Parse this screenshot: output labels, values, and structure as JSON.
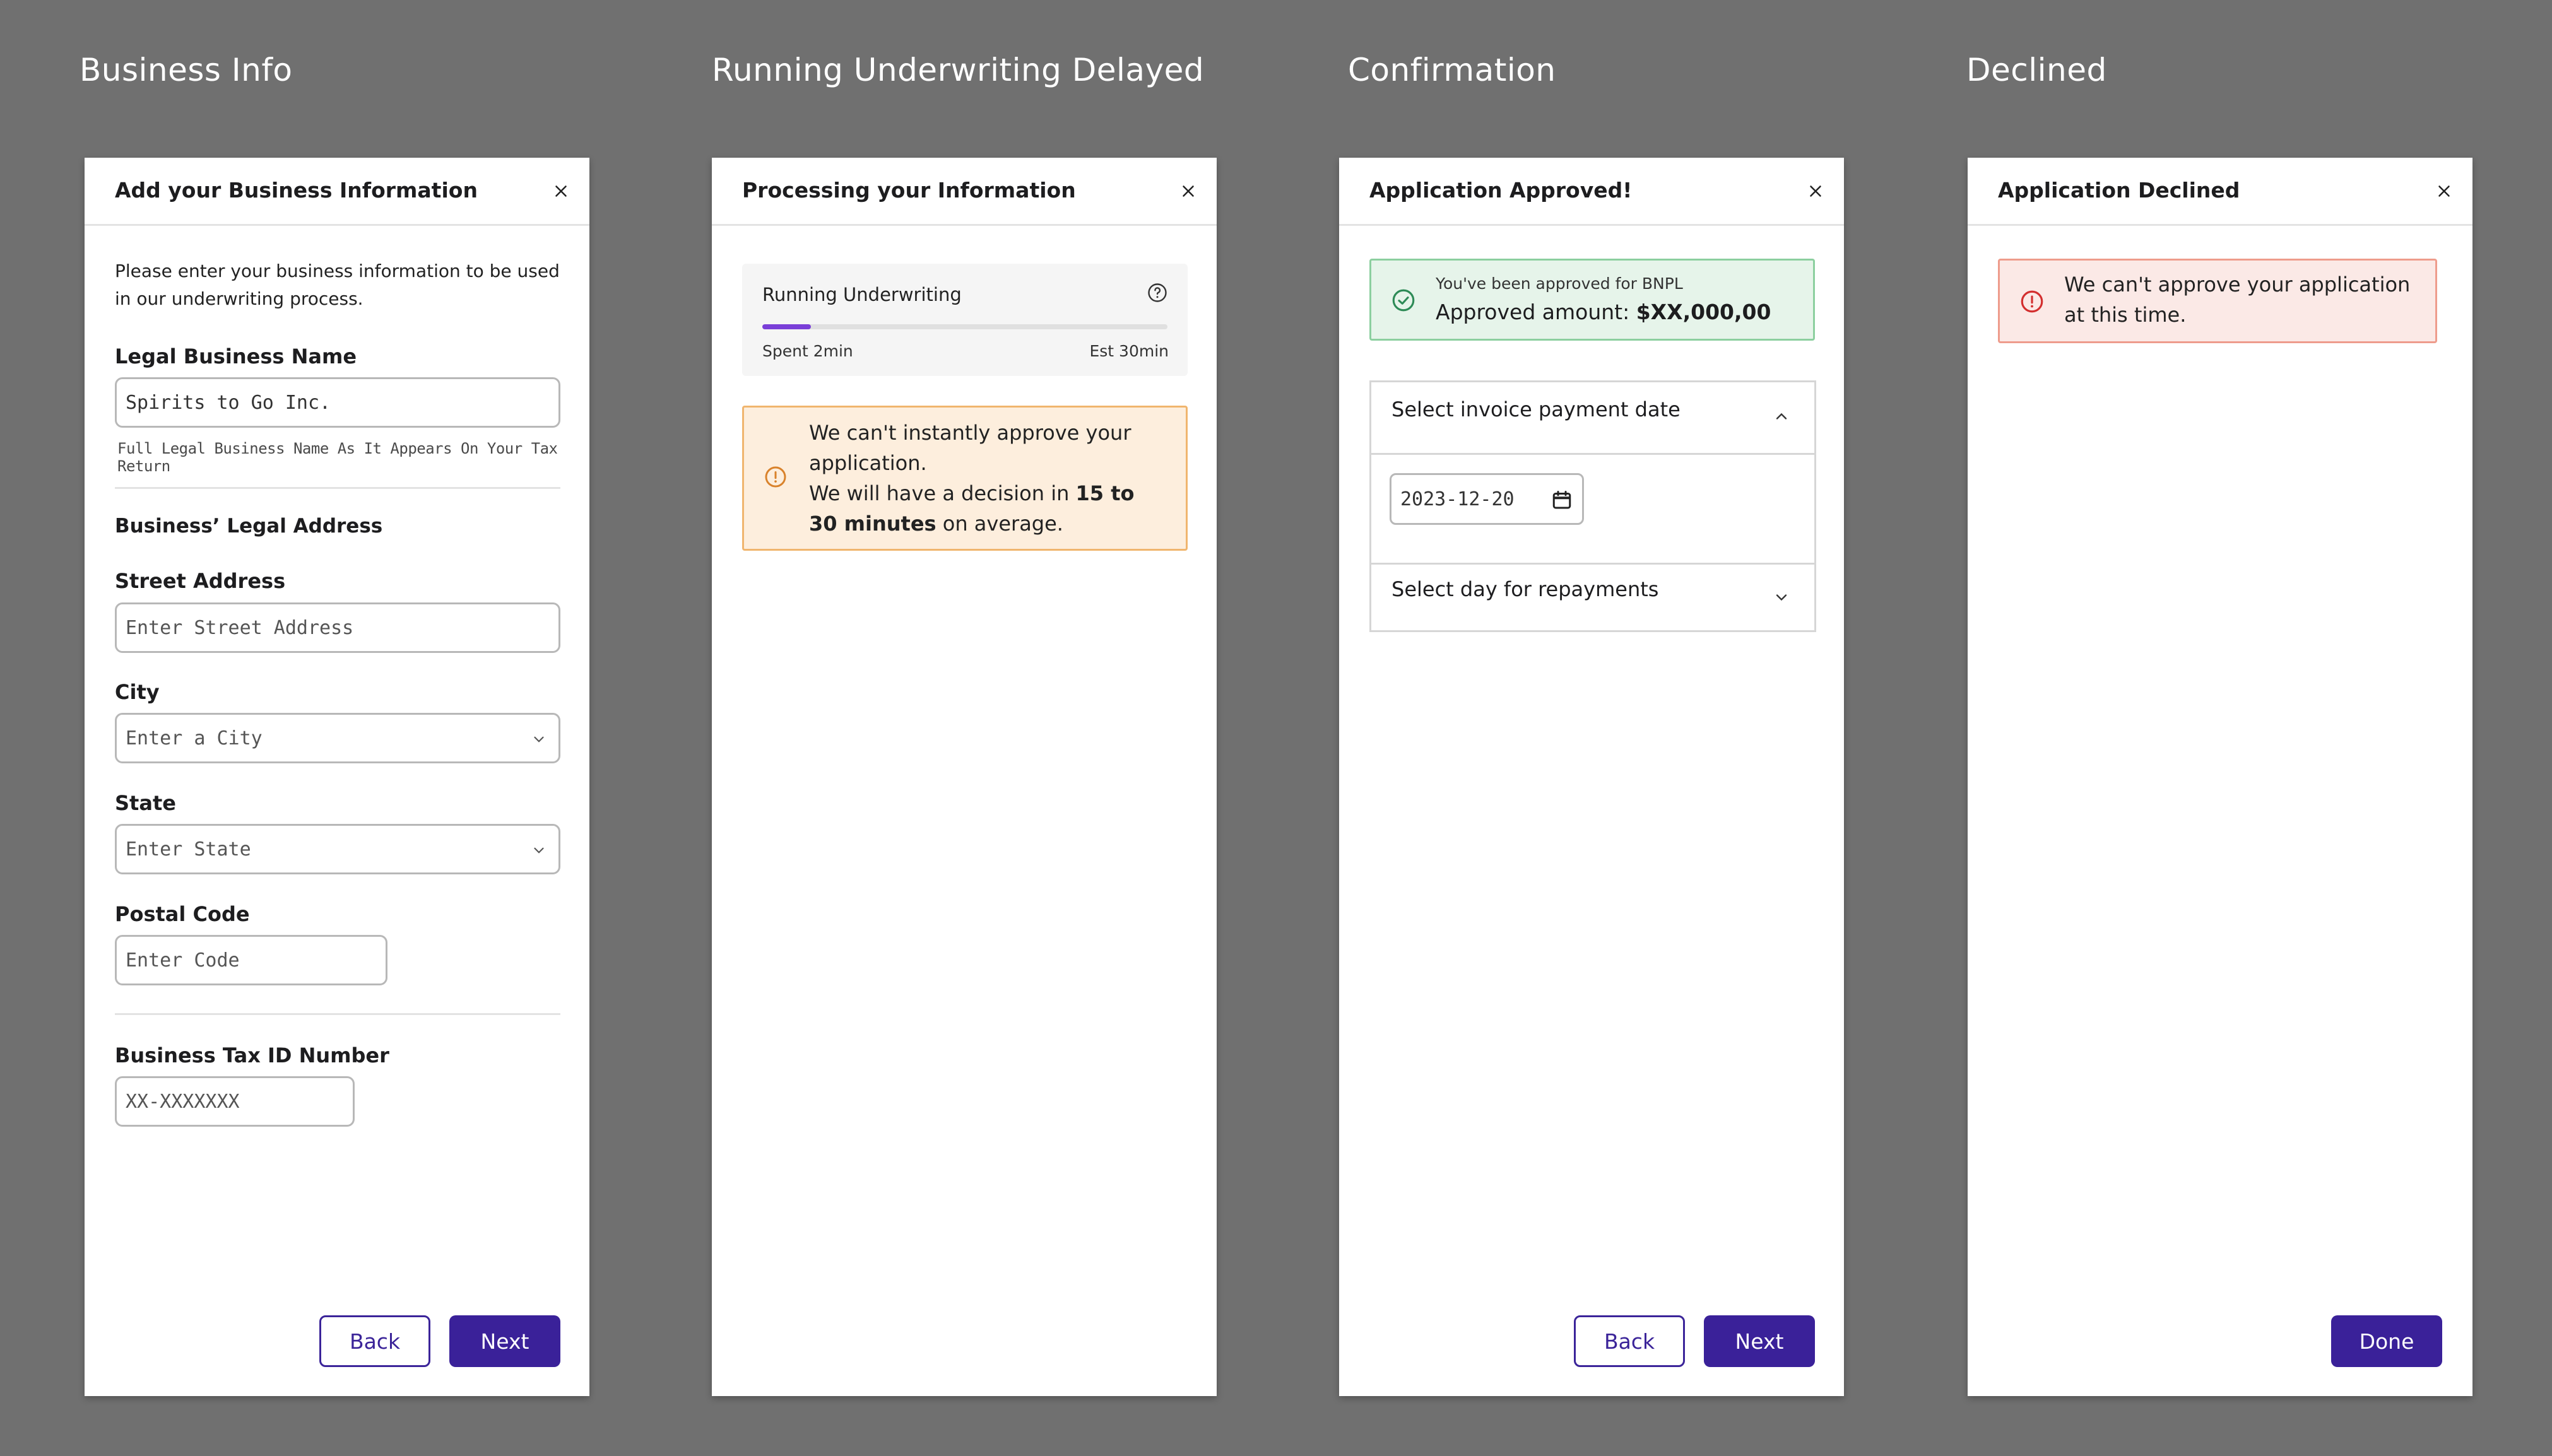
{
  "columns": {
    "business_info": "Business Info",
    "running_underwriting": "Running Underwriting Delayed",
    "confirmation": "Confirmation",
    "declined": "Declined"
  },
  "business_form": {
    "title": "Add your Business Information",
    "intro": "Please enter your business information to be used in our underwriting process.",
    "legal_name_label": "Legal Business Name",
    "legal_name_value": "Spirits to Go Inc.",
    "legal_name_helper": "Full Legal Business Name As It Appears On Your Tax Return",
    "address_section": "Business’ Legal Address",
    "street_label": "Street Address",
    "street_placeholder": "Enter Street Address",
    "city_label": "City",
    "city_placeholder": "Enter a City",
    "state_label": "State",
    "state_placeholder": "Enter State",
    "postal_label": "Postal Code",
    "postal_placeholder": "Enter Code",
    "tax_label": "Business Tax ID Number",
    "tax_placeholder": "XX-XXXXXXX",
    "back": "Back",
    "next": "Next"
  },
  "processing": {
    "title": "Processing your Information",
    "card_title": "Running Underwriting",
    "progress_fraction": 0.12,
    "spent": "Spent 2min",
    "est": "Est 30min",
    "warn_line1": "We can't instantly approve your application.",
    "warn_line2_pre": "We will have a decision in ",
    "warn_line2_bold": "15 to 30 minutes",
    "warn_line2_post": " on average."
  },
  "confirmation": {
    "title": "Application Approved!",
    "approved_small": "You've been approved for BNPL",
    "approved_label": "Approved amount: ",
    "approved_amount": "$XX,000,00",
    "invoice_date_title": "Select invoice payment date",
    "invoice_date_value": "2023-12-20",
    "repayment_title": "Select day for repayments",
    "back": "Back",
    "next": "Next"
  },
  "declined": {
    "title": "Application Declined",
    "message": "We can't approve your application at this time.",
    "done": "Done"
  },
  "colors": {
    "primary": "#3a2199",
    "progress": "#7a3fd8",
    "warning_bg": "#fdeedd",
    "success_bg": "#e6f4ea",
    "error_bg": "#fbe9e6"
  },
  "icons": [
    "close-icon",
    "chevron-down-icon",
    "chevron-up-icon",
    "help-circle-icon",
    "alert-circle-icon",
    "check-circle-icon",
    "calendar-icon"
  ]
}
